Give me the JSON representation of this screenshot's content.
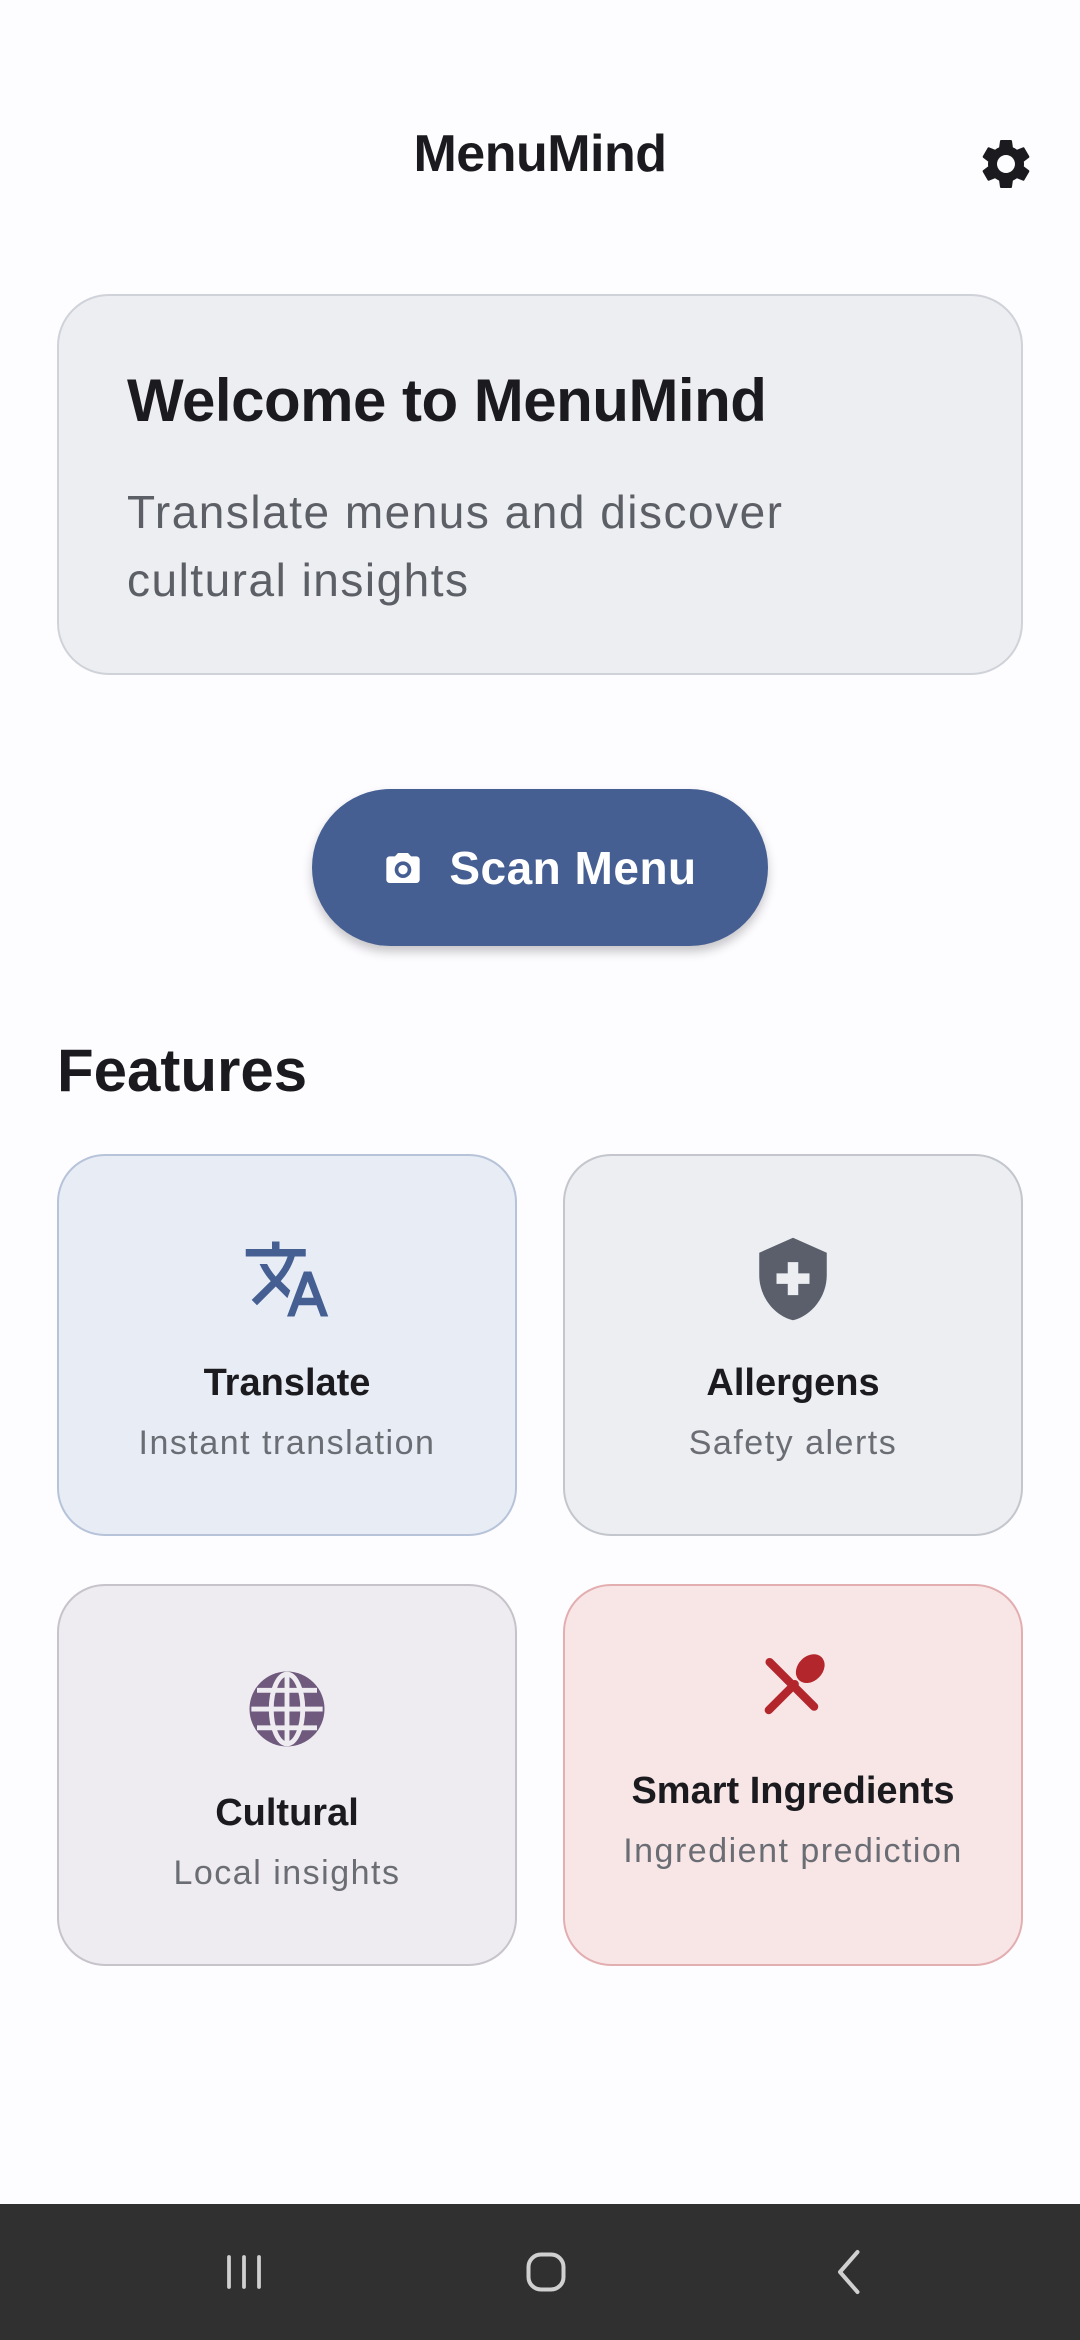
{
  "app_bar": {
    "title": "MenuMind",
    "settings_icon": "gear-icon"
  },
  "welcome": {
    "title": "Welcome to MenuMind",
    "subtitle": "Translate menus and discover cultural insights"
  },
  "scan_button": {
    "label": "Scan Menu",
    "icon": "camera-icon",
    "color": "#455f93"
  },
  "features": {
    "heading": "Features",
    "items": [
      {
        "title": "Translate",
        "description": "Instant translation",
        "icon": "translate-icon",
        "color": "#455f93"
      },
      {
        "title": "Allergens",
        "description": "Safety alerts",
        "icon": "shield-plus-icon",
        "color": "#5a5f6b"
      },
      {
        "title": "Cultural",
        "description": "Local insights",
        "icon": "globe-icon",
        "color": "#6f5a7e"
      },
      {
        "title": "Smart Ingredients",
        "description": "Ingredient prediction",
        "icon": "utensils-icon",
        "color": "#b3262b"
      }
    ]
  },
  "nav_bar": {
    "recents_icon": "recents-icon",
    "home_icon": "home-icon",
    "back_icon": "back-icon"
  }
}
